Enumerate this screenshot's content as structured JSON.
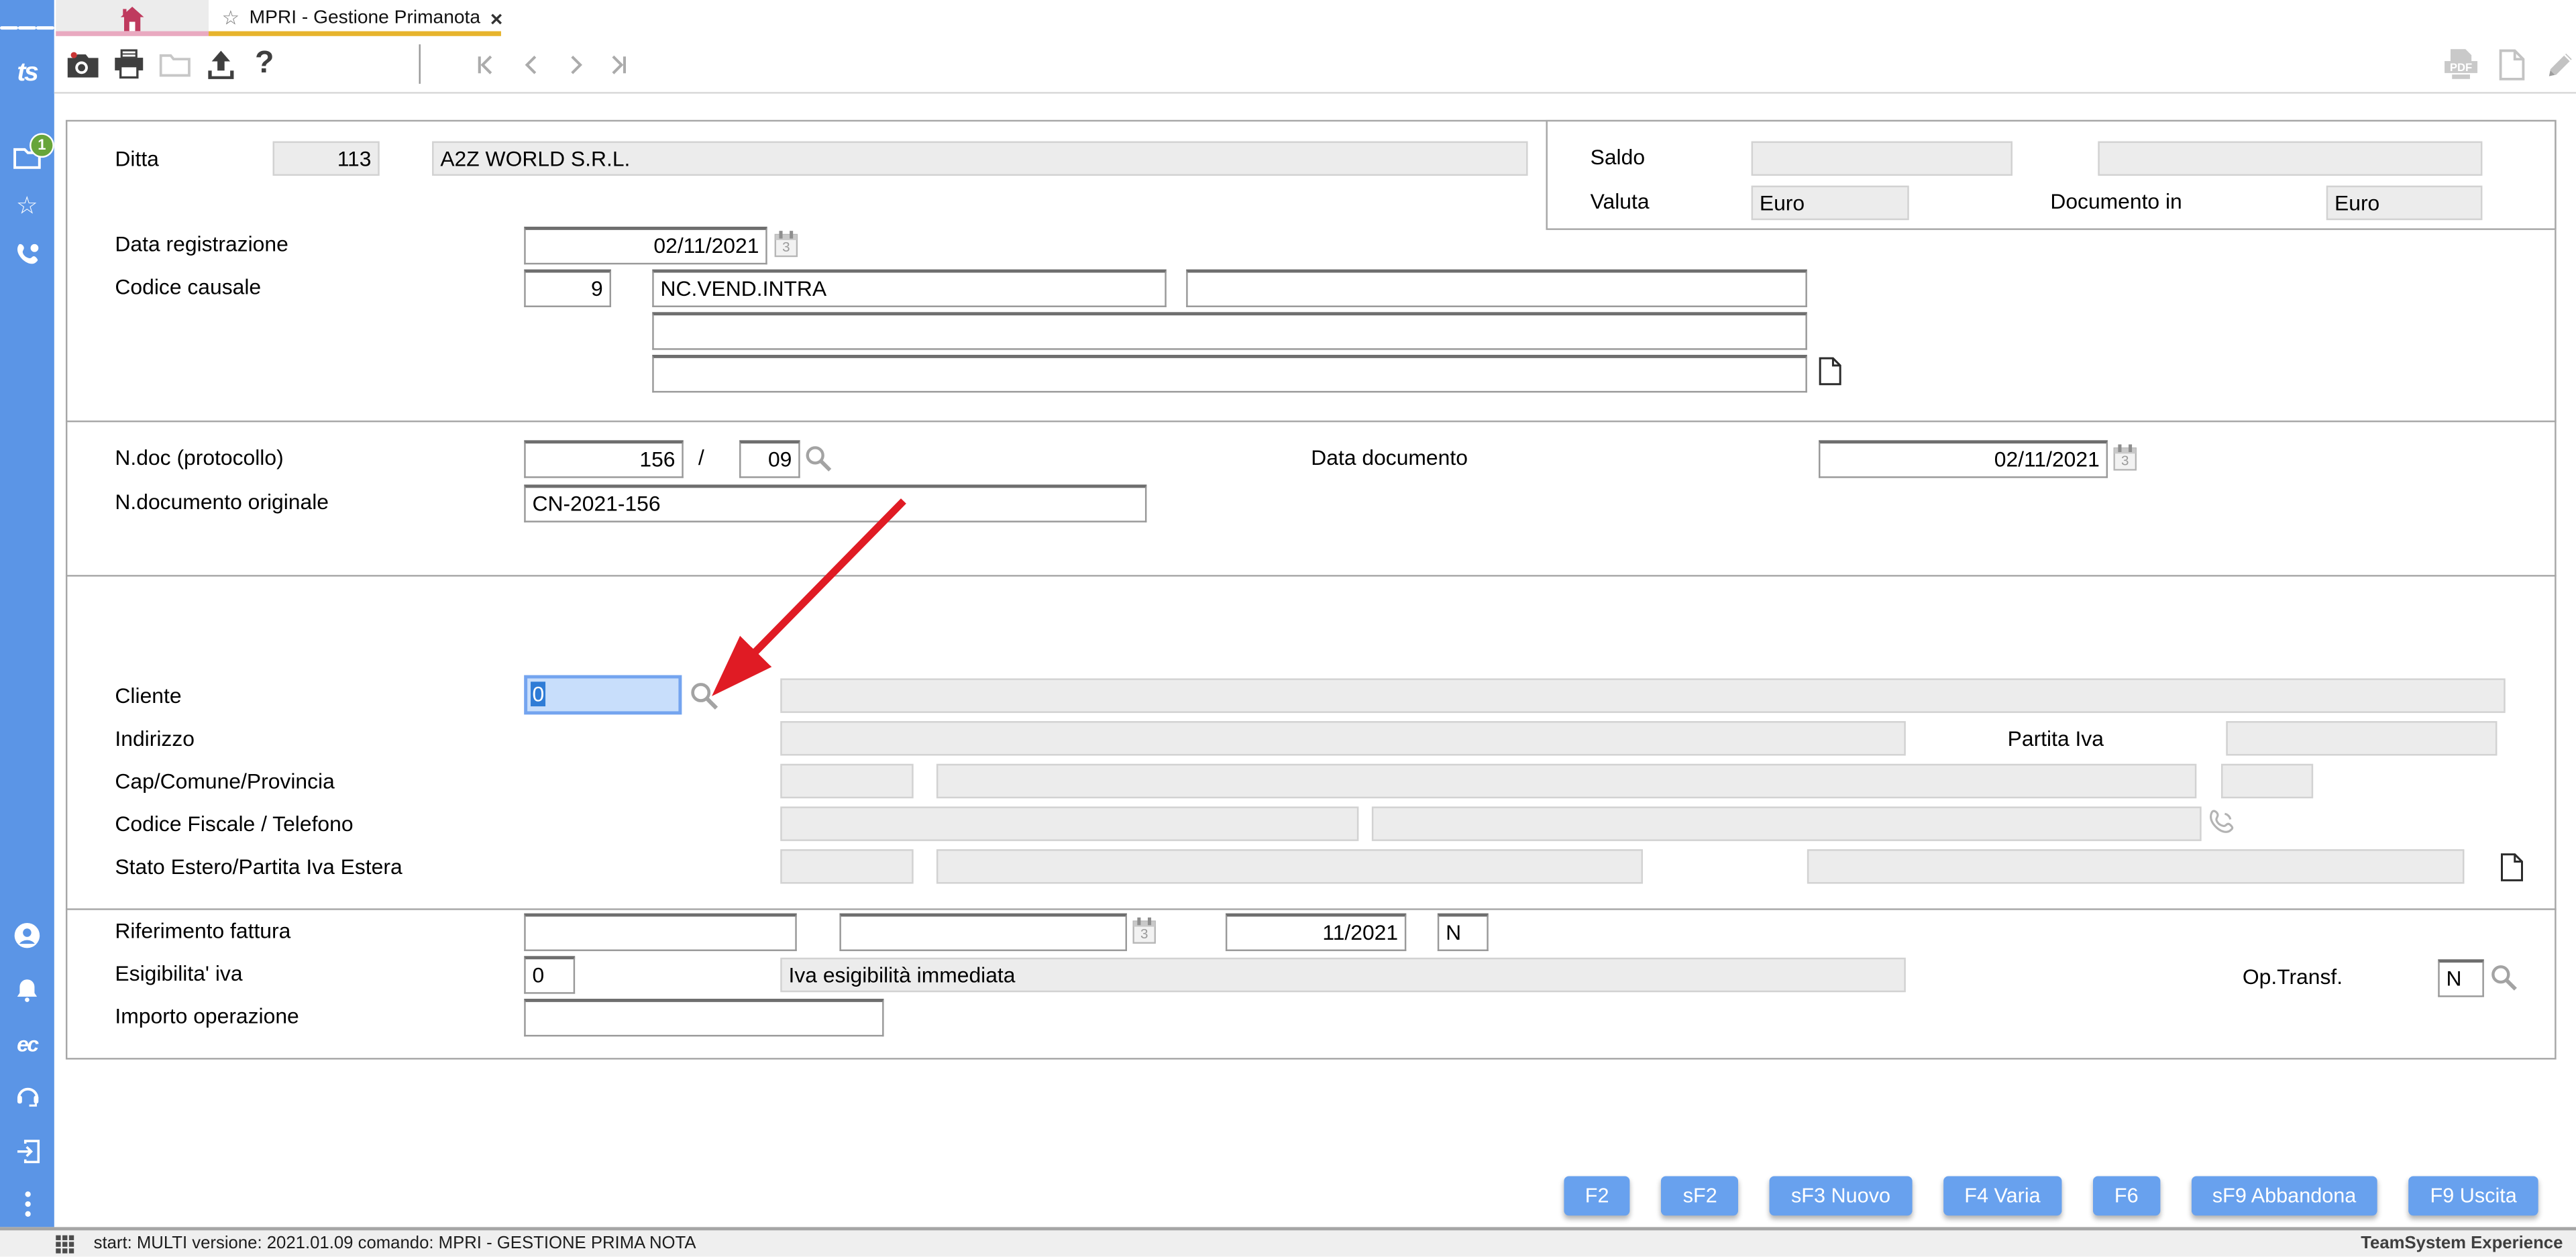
{
  "window": {
    "tab_title": "MPRI - Gestione Primanota",
    "close_glyph": "×",
    "star_glyph": "☆"
  },
  "sidebar": {
    "logo": "ts",
    "notification_badge": "1",
    "ec_logo": "ec",
    "icon_names": [
      "hamburger-icon",
      "ts-logo",
      "folder-notification-icon",
      "star-icon",
      "phone-icon",
      "user-icon",
      "bell-icon",
      "ec-logo",
      "headset-icon",
      "logout-icon",
      "more-dots-icon"
    ]
  },
  "toolbar": {
    "help_label": "?",
    "pdf_label": "PDF",
    "icon_names": [
      "camera-icon",
      "print-icon",
      "folder-icon",
      "upload-icon",
      "help-icon",
      "nav-first-icon",
      "nav-prev-icon",
      "nav-next-icon",
      "nav-last-icon",
      "pdf-icon",
      "page-icon",
      "pencil-icon"
    ]
  },
  "form": {
    "ditta_label": "Ditta",
    "ditta_code": "113",
    "ditta_name": "A2Z WORLD S.R.L.",
    "saldo_label": "Saldo",
    "valuta_label": "Valuta",
    "valuta_value": "Euro",
    "documento_in_label": "Documento in",
    "documento_in_value": "Euro",
    "data_registrazione_label": "Data registrazione",
    "data_registrazione_value": "02/11/2021",
    "codice_causale_label": "Codice causale",
    "codice_causale_code": "9",
    "codice_causale_desc": "NC.VEND.INTRA",
    "ndoc_label": "N.doc (protocollo)",
    "ndoc_numero": "156",
    "ndoc_sep": "/",
    "ndoc_sezione": "09",
    "data_documento_label": "Data documento",
    "data_documento_value": "02/11/2021",
    "ndoc_orig_label": "N.documento originale",
    "ndoc_orig_value": "CN-2021-156",
    "cliente_label": "Cliente",
    "cliente_code": "0",
    "indirizzo_label": "Indirizzo",
    "partita_iva_label": "Partita Iva",
    "cap_label": "Cap/Comune/Provincia",
    "cf_label": "Codice Fiscale / Telefono",
    "stato_label": "Stato Estero/Partita Iva Estera",
    "rif_label": "Riferimento fattura",
    "rif_periodo": "11/2021",
    "rif_flag": "N",
    "esig_label": "Esigibilita' iva",
    "esig_code": "0",
    "esig_desc": "Iva esigibilità immediata",
    "op_transf_label": "Op.Transf.",
    "op_transf_value": "N",
    "importo_label": "Importo operazione"
  },
  "buttons": [
    "F2",
    "sF2",
    "sF3 Nuovo",
    "F4 Varia",
    "F6",
    "sF9 Abbandona",
    "F9 Uscita"
  ],
  "statusbar": {
    "text": "start: MULTI versione: 2021.01.09 comando: MPRI - GESTIONE PRIMA NOTA",
    "brand": "TeamSystem Experience"
  },
  "colors": {
    "sidebar_blue": "#5b95e6",
    "button_blue": "#68a1ee",
    "active_tab_underline": "#e7b42c",
    "home_tab_underline": "#e9a9c0",
    "home_icon": "#bf3a5e",
    "badge_green": "#67a53a",
    "arrow_red": "#e01b24"
  }
}
